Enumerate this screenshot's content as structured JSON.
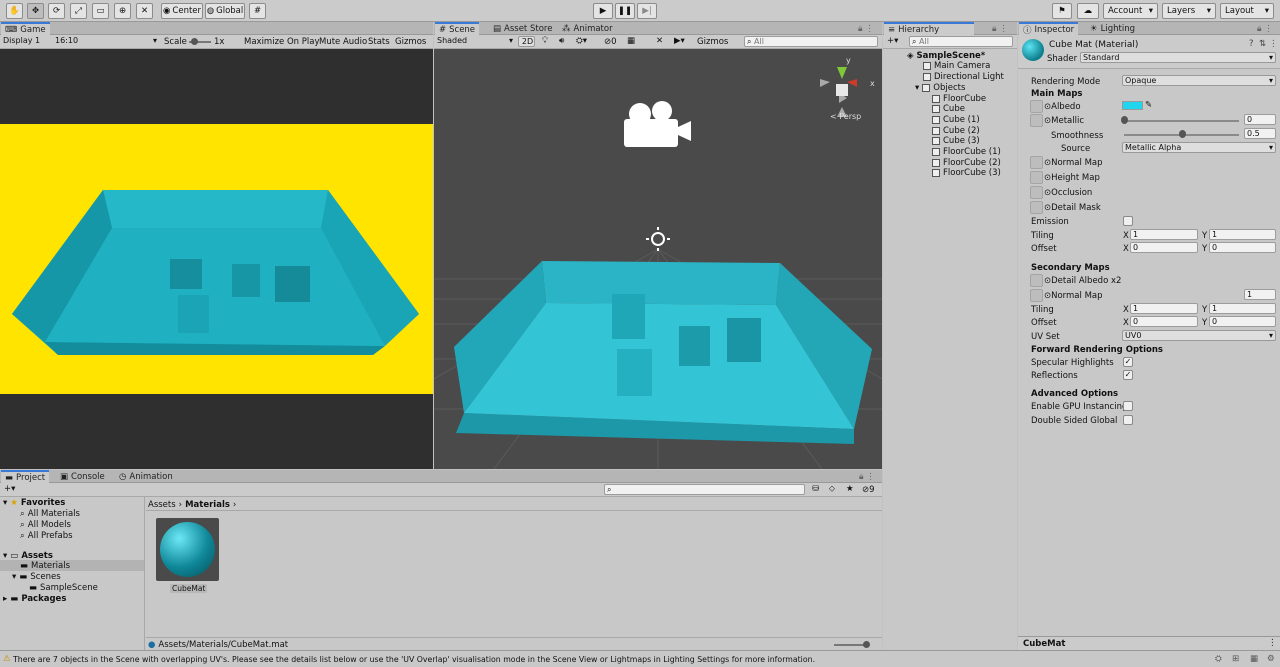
{
  "toolbar": {
    "pivot": "Center",
    "space": "Global",
    "account": "Account",
    "layers": "Layers",
    "layout": "Layout"
  },
  "game": {
    "tab": "Game",
    "display": "Display 1",
    "aspect": "16:10",
    "scale_label": "Scale",
    "scale_value": "1x",
    "maximize": "Maximize On Play",
    "mute": "Mute Audio",
    "stats": "Stats",
    "gizmos": "Gizmos"
  },
  "scene": {
    "tabs": [
      "Scene",
      "Asset Store",
      "Animator"
    ],
    "shading": "Shaded",
    "mode2d": "2D",
    "hidden_count": "0",
    "gizmos": "Gizmos",
    "search_placeholder": "All",
    "persp": "< Persp",
    "axis_x": "x",
    "axis_y": "y"
  },
  "hierarchy": {
    "tab": "Hierarchy",
    "search_placeholder": "All",
    "scene_name": "SampleScene*",
    "items": [
      "Main Camera",
      "Directional Light",
      "Objects"
    ],
    "children": [
      "FloorCube",
      "Cube",
      "Cube (1)",
      "Cube (2)",
      "Cube (3)",
      "FloorCube (1)",
      "FloorCube (2)",
      "FloorCube (3)"
    ]
  },
  "inspector": {
    "tabs": [
      "Inspector",
      "Lighting"
    ],
    "title": "Cube Mat (Material)",
    "shader_label": "Shader",
    "shader_value": "Standard",
    "rendering_mode_label": "Rendering Mode",
    "rendering_mode_value": "Opaque",
    "main_maps": "Main Maps",
    "albedo": "Albedo",
    "albedo_color": "#1fd6ee",
    "metallic": "Metallic",
    "metallic_value": "0",
    "metallic_level": 0,
    "smoothness": "Smoothness",
    "smoothness_value": "0.5",
    "smoothness_level": 0.5,
    "source": "Source",
    "source_value": "Metallic Alpha",
    "normal_map": "Normal Map",
    "height_map": "Height Map",
    "occlusion": "Occlusion",
    "detail_mask": "Detail Mask",
    "emission": "Emission",
    "tiling": "Tiling",
    "offset": "Offset",
    "x": "X",
    "y": "Y",
    "tiling_x": "1",
    "tiling_y": "1",
    "offset_x": "0",
    "offset_y": "0",
    "secondary_maps": "Secondary Maps",
    "detail_albedo": "Detail Albedo x2",
    "secondary_normal": "Normal Map",
    "secondary_normal_value": "1",
    "tiling2_x": "1",
    "tiling2_y": "1",
    "offset2_x": "0",
    "offset2_y": "0",
    "uv_set_label": "UV Set",
    "uv_set_value": "UV0",
    "forward_rendering": "Forward Rendering Options",
    "specular": "Specular Highlights",
    "reflections": "Reflections",
    "advanced": "Advanced Options",
    "gpu_instancing": "Enable GPU Instancing",
    "double_sided": "Double Sided Global Illur",
    "footer": "CubeMat"
  },
  "project": {
    "tabs": [
      "Project",
      "Console",
      "Animation"
    ],
    "favorites": "Favorites",
    "fav_items": [
      "All Materials",
      "All Models",
      "All Prefabs"
    ],
    "assets": "Assets",
    "materials": "Materials",
    "scenes": "Scenes",
    "sample_scene": "SampleScene",
    "packages": "Packages",
    "breadcrumb_root": "Assets",
    "breadcrumb_current": "Materials",
    "asset_name": "CubeMat",
    "path": "Assets/Materials/CubeMat.mat",
    "hidden_count": "9"
  },
  "status": {
    "message": "There are 7 objects in the Scene with overlapping UV's. Please see the details list below or use the 'UV Overlap' visualisation mode in the Scene View or Lightmaps in Lighting Settings for more information."
  },
  "colors": {
    "teal": "#1aa7b8",
    "yellow": "#ffe400",
    "scene_bg": "#4a4a4a"
  }
}
